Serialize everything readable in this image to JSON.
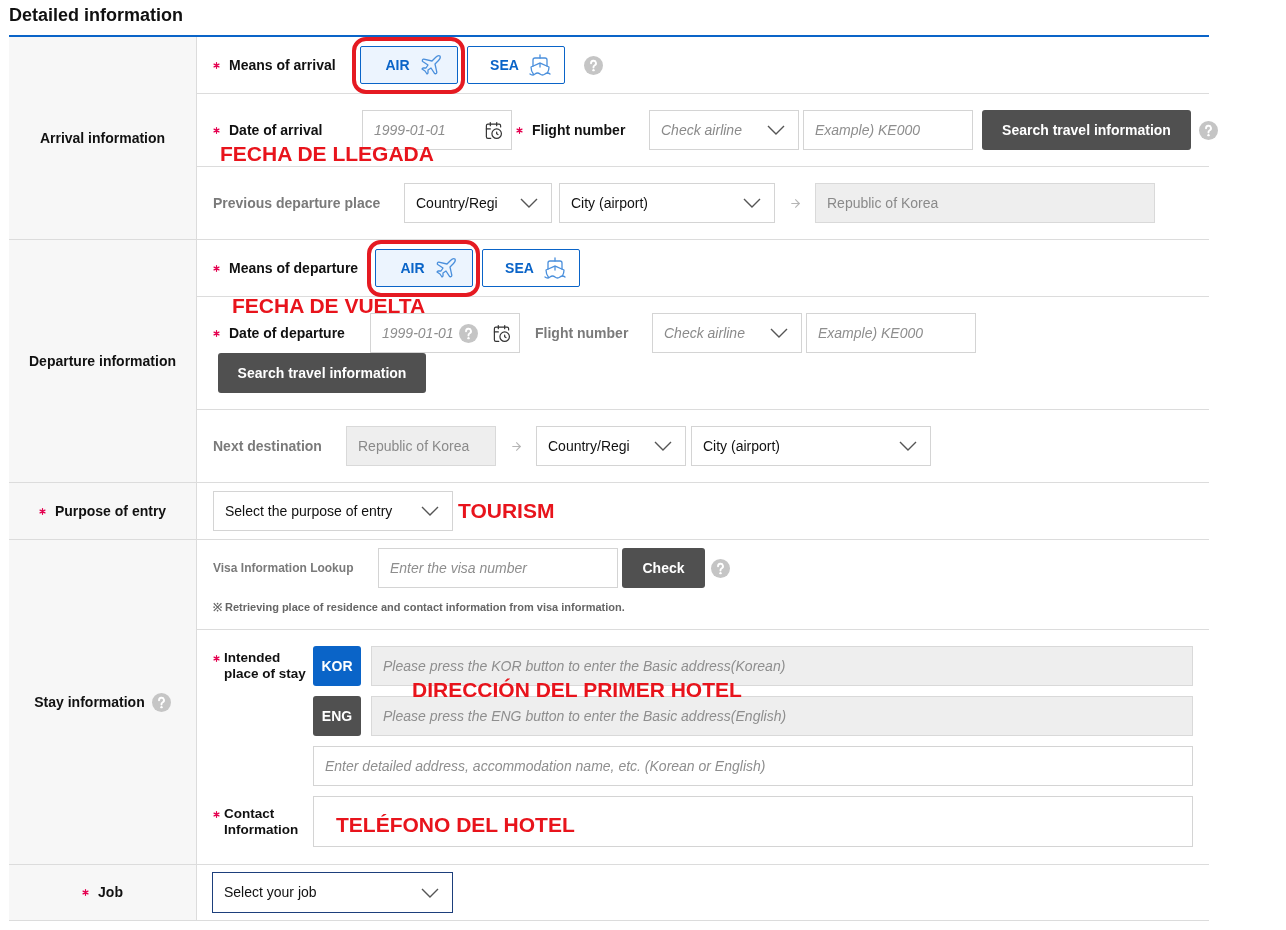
{
  "title": "Detailed information",
  "arrival": {
    "heading": "Arrival information",
    "means": {
      "label": "Means of arrival",
      "required": true,
      "options": [
        {
          "kind": "air",
          "label": "AIR",
          "selected": true,
          "circled": true
        },
        {
          "kind": "sea",
          "label": "SEA",
          "selected": false,
          "circled": false
        }
      ]
    },
    "date": {
      "label": "Date of arrival",
      "required": true,
      "placeholder": "1999-01-01"
    },
    "flight": {
      "label": "Flight number",
      "required": true,
      "airline": {
        "placeholder": "Check airline"
      },
      "number": {
        "placeholder": "Example) KE000"
      }
    },
    "search_button": "Search travel information",
    "annotation": "FECHA DE LLEGADA",
    "route": {
      "label": "Previous departure place",
      "required": false,
      "country": {
        "value": "Country/Regi"
      },
      "city": {
        "value": "City (airport)"
      },
      "korea": {
        "value": "Republic of Korea",
        "disabled": true
      }
    }
  },
  "departure": {
    "heading": "Departure information",
    "means": {
      "label": "Means of departure",
      "required": true,
      "options": [
        {
          "kind": "air",
          "label": "AIR",
          "selected": true,
          "circled": true
        },
        {
          "kind": "sea",
          "label": "SEA",
          "selected": false,
          "circled": false
        }
      ]
    },
    "annotation": "FECHA DE VUELTA",
    "date": {
      "label": "Date of departure",
      "required": true,
      "placeholder": "1999-01-01"
    },
    "flight": {
      "label": "Flight number",
      "required": false,
      "airline": {
        "placeholder": "Check airline"
      },
      "number": {
        "placeholder": "Example) KE000"
      }
    },
    "search_button": "Search travel information",
    "route": {
      "label": "Next destination",
      "required": false,
      "korea": {
        "value": "Republic of Korea",
        "disabled": true
      },
      "country": {
        "value": "Country/Regi"
      },
      "city": {
        "value": "City (airport)"
      }
    }
  },
  "purpose": {
    "heading": "Purpose of entry",
    "required": true,
    "select": {
      "value": "Select the purpose of entry",
      "focused": false
    },
    "annotation": "TOURISM"
  },
  "stay": {
    "heading": "Stay information",
    "visa_lookup": {
      "label": "Visa Information Lookup",
      "required": false,
      "placeholder": "Enter the visa number",
      "button": "Check",
      "note": "※ Retrieving place of residence and contact information from visa information."
    },
    "place": {
      "label": "Intended place of stay",
      "required": true,
      "address_buttons": [
        {
          "kind": "korean",
          "label": "KOR",
          "placeholder": "Please press the KOR button to enter the Basic address(Korean)",
          "disabled": true
        },
        {
          "kind": "english",
          "label": "ENG",
          "placeholder": "Please press the ENG button to enter the Basic address(English)",
          "disabled": true
        }
      ],
      "detail": {
        "placeholder": "Enter detailed address, accommodation name, etc. (Korean or English)",
        "disabled": false
      },
      "annotation": "DIRECCIÓN DEL PRIMER HOTEL"
    },
    "contact": {
      "label": "Contact Information",
      "required": true,
      "annotation": "TELÉFONO DEL HOTEL"
    }
  },
  "job": {
    "heading": "Job",
    "required": true,
    "select": {
      "value": "Select your job",
      "focused": true
    }
  }
}
